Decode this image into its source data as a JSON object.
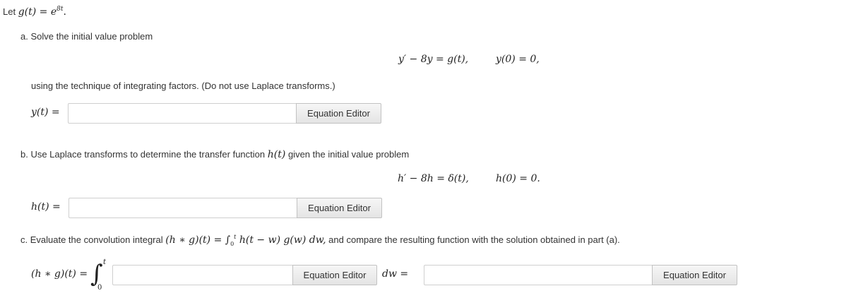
{
  "intro": {
    "let_text": "Let",
    "definition_math": "g(t) = e",
    "exponent": "8t",
    "period": "."
  },
  "part_a": {
    "heading": "a. Solve the initial value problem",
    "equation": "y′ − 8y = g(t),",
    "initial_condition": "y(0) = 0,",
    "instruction": "using the technique of integrating factors. (Do not use Laplace transforms.)",
    "answer_label": "y(t) =",
    "answer_value": "",
    "editor_button": "Equation Editor"
  },
  "part_b": {
    "heading_prefix": "b. Use Laplace transforms to determine the transfer function",
    "heading_math": "h(t)",
    "heading_suffix": "given the initial value problem",
    "equation": "h′ − 8h = δ(t),",
    "initial_condition": "h(0) = 0.",
    "answer_label": "h(t) =",
    "answer_value": "",
    "editor_button": "Equation Editor"
  },
  "part_c": {
    "heading_prefix": "c. Evaluate the convolution integral",
    "heading_math_left": "(h ∗ g)(t) =",
    "heading_integral": "∫",
    "heading_upper": "t",
    "heading_lower": "0",
    "heading_math_right": "h(t − w) g(w) dw,",
    "heading_suffix": "and compare the resulting function with the solution obtained in part (a).",
    "answer_label": "(h ∗ g)(t) =",
    "integral_sign": "∫",
    "upper_limit": "t",
    "lower_limit": "0",
    "integrand_value": "",
    "editor_button_1": "Equation Editor",
    "dw_label": "dw =",
    "result_value": "",
    "editor_button_2": "Equation Editor"
  }
}
